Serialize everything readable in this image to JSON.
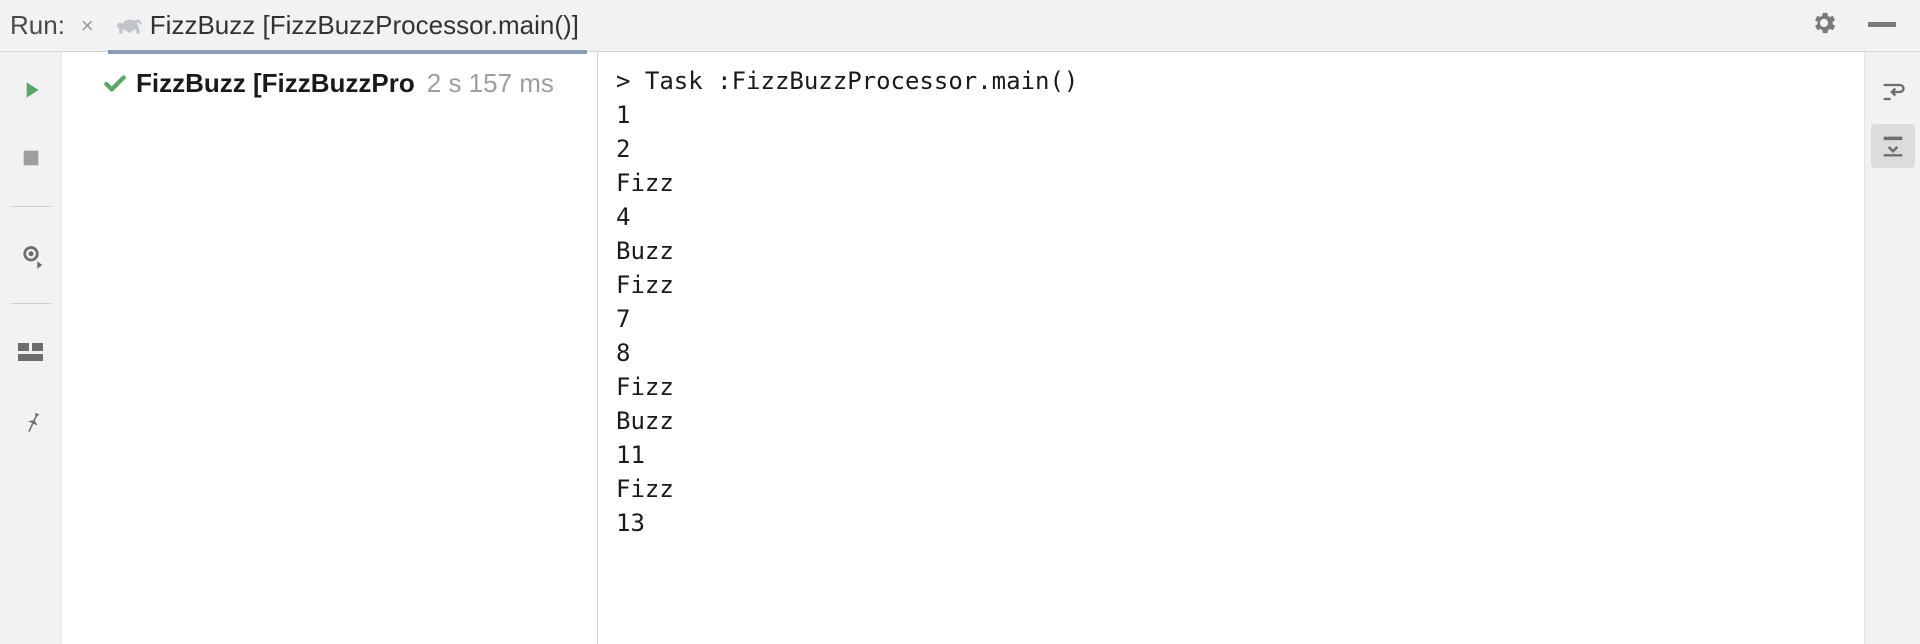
{
  "header": {
    "run_label": "Run:",
    "tab_title": "FizzBuzz [FizzBuzzProcessor.main()]"
  },
  "tree": {
    "item_name": "FizzBuzz [FizzBuzzPro",
    "item_time": "2 s 157 ms"
  },
  "console": {
    "lines": [
      "> Task :FizzBuzzProcessor.main()",
      "1",
      "2",
      "Fizz",
      "4",
      "Buzz",
      "Fizz",
      "7",
      "8",
      "Fizz",
      "Buzz",
      "11",
      "Fizz",
      "13"
    ]
  },
  "colors": {
    "success": "#59a869",
    "muted": "#9e9e9e",
    "panel": "#f2f2f2"
  }
}
